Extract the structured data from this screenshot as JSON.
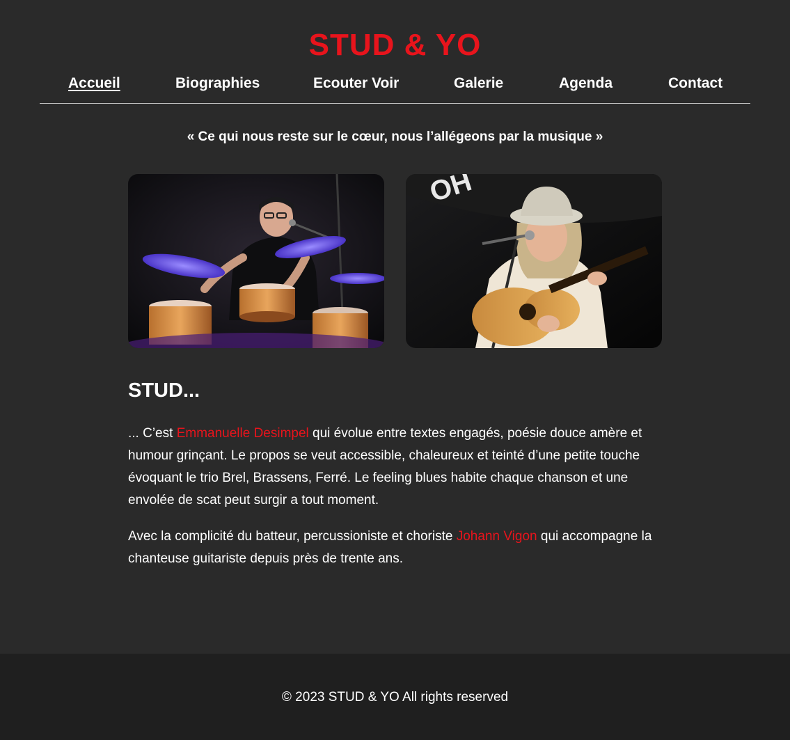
{
  "site": {
    "title": "STUD & YO",
    "accent": "#e8141c",
    "background": "#2a2a2a"
  },
  "nav": {
    "items": [
      {
        "label": "Accueil",
        "active": true
      },
      {
        "label": "Biographies"
      },
      {
        "label": "Ecouter Voir"
      },
      {
        "label": "Galerie"
      },
      {
        "label": "Agenda"
      },
      {
        "label": "Contact"
      }
    ]
  },
  "tagline": "« Ce qui nous reste sur le cœur, nous l’allégeons par la musique »",
  "photos": [
    {
      "icon": "drummer-photo"
    },
    {
      "icon": "guitarist-singer-photo"
    }
  ],
  "section": {
    "heading": "STUD...",
    "p1_before": "... C’est ",
    "p1_link": "Emmanuelle Desimpel",
    "p1_after": " qui évolue entre textes engagés, poésie douce amère et humour grinçant. Le propos se veut accessible, chaleureux et teinté d’une petite touche évoquant le trio Brel, Brassens, Ferré. Le feeling blues habite chaque chanson et une envolée de scat peut surgir a tout moment.",
    "p2_before": "Avec la complicité du batteur, percussioniste et choriste ",
    "p2_link": "Johann Vigon",
    "p2_after": " qui accompagne la chanteuse guitariste depuis près de trente ans."
  },
  "footer": {
    "text": "© 2023 STUD & YO All rights reserved"
  }
}
